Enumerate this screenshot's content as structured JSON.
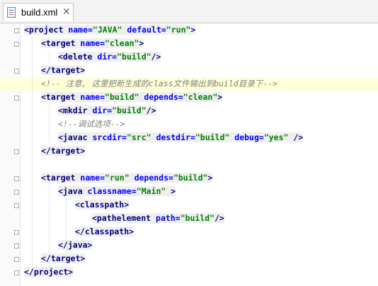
{
  "tab": {
    "title": "build.xml",
    "close": "✕",
    "icon": "xml-file-icon"
  },
  "code": {
    "l1": {
      "open": "<project",
      "a1": " name=",
      "v1": "\"JAVA\"",
      "a2": " default=",
      "v2": "\"run\"",
      "close": ">"
    },
    "l2": {
      "open": "<target",
      "a1": " name=",
      "v1": "\"clean\"",
      "close": ">"
    },
    "l3": {
      "open": "<delete",
      "a1": " dir=",
      "v1": "\"build\"",
      "close": "/>"
    },
    "l4": {
      "tag": "</target>"
    },
    "l5": {
      "comment": "<!-- 注意, 这里把新生成的class文件输出到build目录下-->"
    },
    "l6": {
      "open": "<target",
      "a1": " name=",
      "v1": "\"build\"",
      "a2": " depends=",
      "v2": "\"clean\"",
      "close": ">"
    },
    "l7": {
      "open": "<mkdir",
      "a1": " dir=",
      "v1": "\"build\"",
      "close": "/>"
    },
    "l8": {
      "comment": "<!--调试选项-->"
    },
    "l9": {
      "open": "<javac",
      "a1": " srcdir=",
      "v1": "\"src\"",
      "a2": " destdir=",
      "v2": "\"build\"",
      "a3": " debug=",
      "v3": "\"yes\"",
      "close": " />"
    },
    "l10": {
      "tag": "</target>"
    },
    "l12": {
      "open": "<target",
      "a1": " name=",
      "v1": "\"run\"",
      "a2": " depends=",
      "v2": "\"build\"",
      "close": ">"
    },
    "l13": {
      "open": "<java",
      "a1": " classname=",
      "v1": "\"Main\"",
      "close": " >"
    },
    "l14": {
      "tag": "<classpath>"
    },
    "l15": {
      "open": "<pathelement",
      "a1": " path=",
      "v1": "\"build\"",
      "close": "/>"
    },
    "l16": {
      "tag": "</classpath>"
    },
    "l17": {
      "tag": "</java>"
    },
    "l18": {
      "tag": "</target>"
    },
    "l19": {
      "tag": "</project>"
    }
  }
}
